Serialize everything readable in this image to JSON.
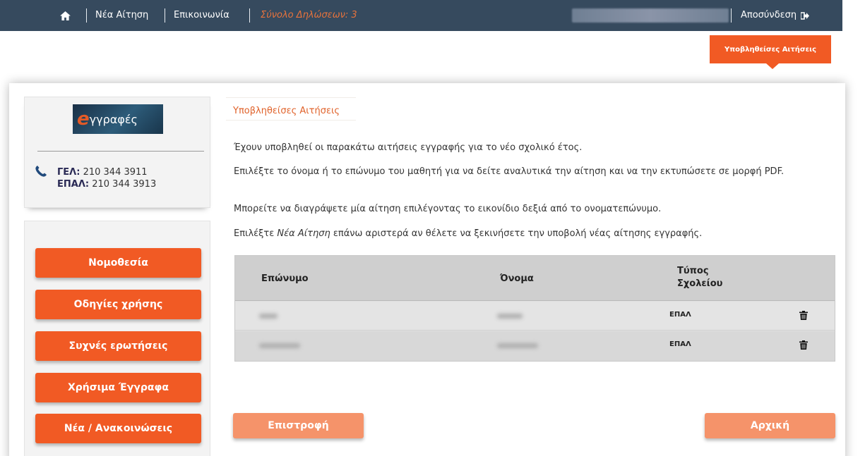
{
  "topbar": {
    "home_icon": "home-icon",
    "new_application": "Νέα Αίτηση",
    "contact": "Επικοινωνία",
    "total_declarations": "Σύνολο Δηλώσεων: 3",
    "logout": "Αποσύνδεση",
    "logout_icon": "sign-out-icon"
  },
  "sub_tab": {
    "label": "Υποβληθείσες Αιτήσεις"
  },
  "sidebar": {
    "logo": {
      "e": "e",
      "text": "γγραφές"
    },
    "phone_icon": "phone-icon",
    "phones": [
      {
        "label": "ΓΕΛ:",
        "number": "210 344 3911"
      },
      {
        "label": "ΕΠΑΛ:",
        "number": "210 344 3913"
      }
    ],
    "menu": [
      {
        "label": "Νομοθεσία"
      },
      {
        "label": "Οδηγίες χρήσης"
      },
      {
        "label": "Συχνές ερωτήσεις"
      },
      {
        "label": "Χρήσιμα Έγγραφα"
      },
      {
        "label": "Νέα / Ανακοινώσεις"
      }
    ]
  },
  "main": {
    "title": "Υποβληθείσες Αιτήσεις",
    "paragraphs": {
      "p1": "Έχουν υποβληθεί οι παρακάτω αιτήσεις εγγραφής για το νέο σχολικό έτος.",
      "p2": "Επιλέξτε το όνομα ή το επώνυμο του μαθητή για να δείτε αναλυτικά την αίτηση και να την εκτυπώσετε σε μορφή PDF.",
      "p3": "Μπορείτε να διαγράψετε μία αίτηση επιλέγοντας το εικονίδιο δεξιά από το ονοματεπώνυμο.",
      "p4_prefix": "Επιλέξτε ",
      "p4_italic": "Νέα Αίτηση",
      "p4_suffix": " επάνω αριστερά αν θέλετε να ξεκινήσετε την υποβολή νέας αίτησης εγγραφής."
    },
    "table": {
      "headers": {
        "last_name": "Επώνυμο",
        "first_name": "Όνομα",
        "school_type_1": "Τύπος",
        "school_type_2": "Σχολείου"
      },
      "rows": [
        {
          "school_type": "ΕΠΑΛ",
          "delete_icon": "trash-icon"
        },
        {
          "school_type": "ΕΠΑΛ",
          "delete_icon": "trash-icon"
        }
      ]
    },
    "buttons": {
      "back": "Επιστροφή",
      "home": "Αρχική"
    }
  },
  "colors": {
    "navbar": "#364a5e",
    "accent": "#f15a24",
    "accent_light": "#f5936a",
    "count_text": "#e8733c"
  }
}
